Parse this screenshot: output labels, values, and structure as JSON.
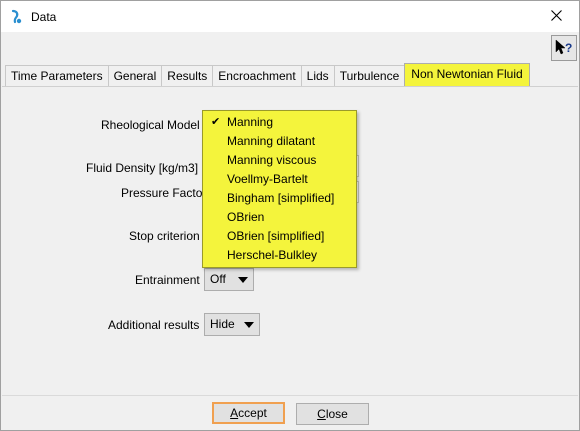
{
  "window": {
    "title": "Data",
    "app_icon": "drop-icon",
    "close_icon": "close-icon",
    "help_icon": "context-help-icon"
  },
  "tabs": [
    {
      "label": "Time Parameters",
      "active": false
    },
    {
      "label": "General",
      "active": false
    },
    {
      "label": "Results",
      "active": false
    },
    {
      "label": "Encroachment",
      "active": false
    },
    {
      "label": "Lids",
      "active": false
    },
    {
      "label": "Turbulence",
      "active": false
    },
    {
      "label": "Non Newtonian Fluid",
      "active": true
    }
  ],
  "form": {
    "rheological_model_label": "Rheological Model",
    "fluid_density_label": "Fluid Density [kg/m3]",
    "pressure_factor_label": "Pressure Factor",
    "stop_criterion_label": "Stop criterion",
    "entrainment_label": "Entrainment",
    "entrainment_value": "Off",
    "additional_results_label": "Additional results",
    "additional_results_value": "Hide"
  },
  "dropdown": {
    "selected": "Manning",
    "check_mark": "✔",
    "options": [
      "Manning",
      "Manning dilatant",
      "Manning viscous",
      "Voellmy-Bartelt",
      "Bingham [simplified]",
      "OBrien",
      "OBrien [simplified]",
      "Herschel-Bulkley"
    ]
  },
  "buttons": {
    "accept_mnemonic": "A",
    "accept_rest": "ccept",
    "close_mnemonic": "C",
    "close_rest": "lose"
  },
  "colors": {
    "highlight": "#f4f43c",
    "default_button_border": "#f0a050"
  }
}
